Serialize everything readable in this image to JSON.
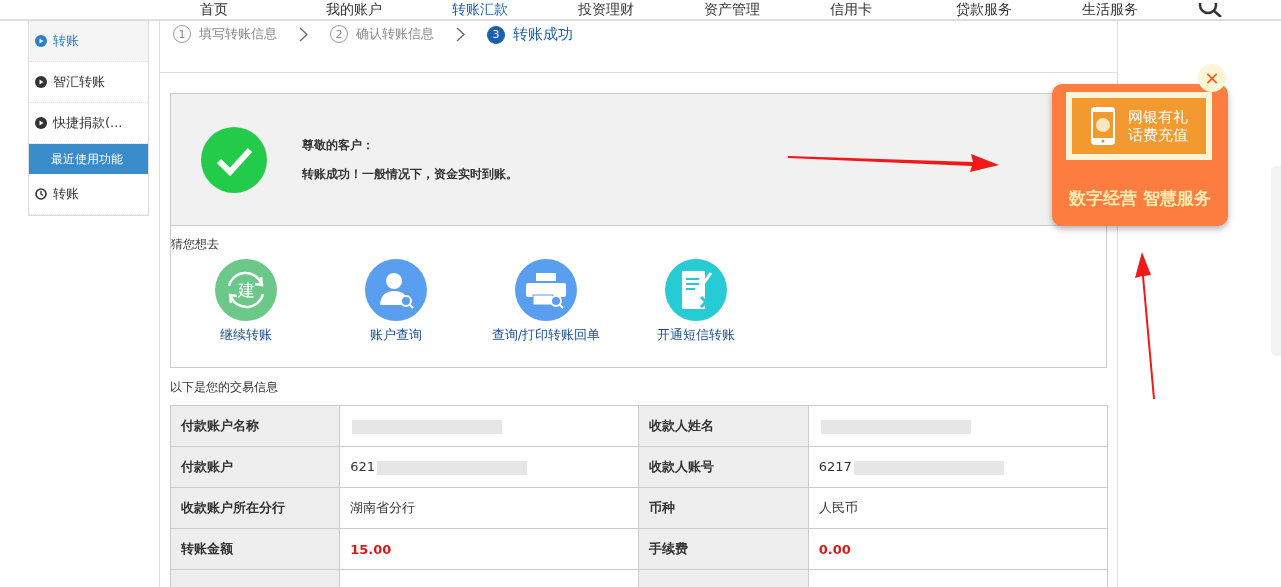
{
  "nav": {
    "items": [
      {
        "label": "首页",
        "selected": false
      },
      {
        "label": "我的账户",
        "selected": false
      },
      {
        "label": "转账汇款",
        "selected": true
      },
      {
        "label": "投资理财",
        "selected": false
      },
      {
        "label": "资产管理",
        "selected": false
      },
      {
        "label": "信用卡",
        "selected": false
      },
      {
        "label": "贷款服务",
        "selected": false
      },
      {
        "label": "生活服务",
        "selected": false
      }
    ]
  },
  "sidebar": {
    "items": [
      {
        "kind": "link",
        "label": "转账",
        "selected": true
      },
      {
        "kind": "link",
        "label": "智汇转账",
        "selected": false
      },
      {
        "kind": "link",
        "label": "快捷捐款(...",
        "selected": false
      },
      {
        "kind": "header",
        "label": "最近使用功能"
      },
      {
        "kind": "recent",
        "label": "转账",
        "selected": false
      }
    ]
  },
  "steps": [
    {
      "number": "1",
      "label": "填写转账信息",
      "selected": false
    },
    {
      "number": "2",
      "label": "确认转账信息",
      "selected": false
    },
    {
      "number": "3",
      "label": "转账成功",
      "selected": true
    }
  ],
  "result": {
    "title": "尊敬的客户：",
    "message": "转账成功！一般情况下，资金实时到账。"
  },
  "suggestions": {
    "title": "猜您想去",
    "items": [
      {
        "kind": "repeat",
        "label": "继续转账",
        "glyph": "建"
      },
      {
        "kind": "account",
        "label": "账户查询"
      },
      {
        "kind": "print",
        "label": "查询/打印转账回单"
      },
      {
        "kind": "sms",
        "label": "开通短信转账"
      }
    ]
  },
  "details": {
    "title": "以下是您的交易信息",
    "rows": [
      [
        {
          "label": "付款账户名称",
          "redacted": true
        },
        {
          "label": "收款人姓名",
          "redacted": true
        }
      ],
      [
        {
          "label": "付款账户",
          "value": "621",
          "kind": "plain",
          "redacted": true
        },
        {
          "label": "收款人账号",
          "value": "6217",
          "kind": "plain",
          "redacted": true
        }
      ],
      [
        {
          "label": "收款账户所在分行",
          "value": "湖南省分行",
          "kind": "plain"
        },
        {
          "label": "币种",
          "value": "人民币",
          "kind": "plain"
        }
      ],
      [
        {
          "label": "转账金额",
          "value": "15.00",
          "kind": "amount"
        },
        {
          "label": "手续费",
          "value": "0.00",
          "kind": "amount"
        }
      ]
    ]
  },
  "promo": {
    "close": "✕",
    "card_line_1": "网银有礼",
    "card_line_2": "话费充值",
    "banner": "数字经营 智慧服务"
  }
}
